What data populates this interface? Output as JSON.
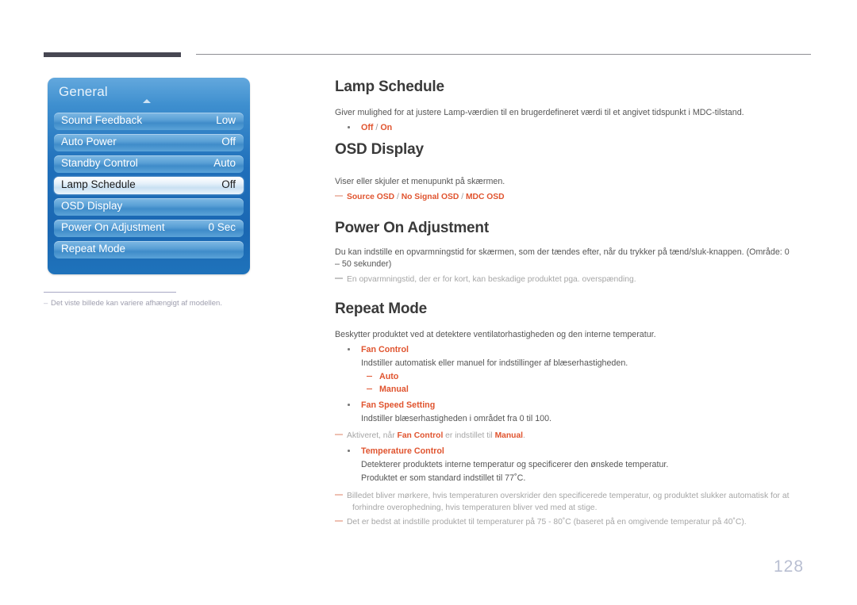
{
  "page": {
    "number": "128",
    "language": "da"
  },
  "osd_menu": {
    "title": "General",
    "caret_icon": "caret-up-icon",
    "rows": [
      {
        "label": "Sound Feedback",
        "value": "Low",
        "selected": false
      },
      {
        "label": "Auto Power",
        "value": "Off",
        "selected": false
      },
      {
        "label": "Standby Control",
        "value": "Auto",
        "selected": false
      },
      {
        "label": "Lamp Schedule",
        "value": "Off",
        "selected": true
      },
      {
        "label": "OSD Display",
        "value": "",
        "selected": false
      },
      {
        "label": "Power On Adjustment",
        "value": "0 Sec",
        "selected": false
      },
      {
        "label": "Repeat Mode",
        "value": "",
        "selected": false
      }
    ],
    "footnote_dash": "–",
    "footnote": "Det viste billede kan variere afhængigt af modellen."
  },
  "sections": {
    "lamp_schedule": {
      "heading": "Lamp Schedule",
      "body": "Giver mulighed for at justere Lamp-værdien til en brugerdefineret værdi til et angivet tidspunkt i MDC-tilstand.",
      "option_off": "Off",
      "option_slash": " / ",
      "option_on": "On"
    },
    "osd_display": {
      "heading": "OSD Display",
      "body": "Viser eller skjuler et menupunkt på skærmen.",
      "opt1": "Source OSD",
      "sep1": " / ",
      "opt2": "No Signal OSD",
      "sep2": " / ",
      "opt3": "MDC OSD"
    },
    "power_on_adjustment": {
      "heading": "Power On Adjustment",
      "body": "Du kan indstille en opvarmningstid for skærmen, som der tændes efter, når du trykker på tænd/sluk-knappen. (Område: 0 – 50 sekunder)",
      "note": "En opvarmningstid, der er for kort, kan beskadige produktet pga. overspænding."
    },
    "repeat_mode": {
      "heading": "Repeat Mode",
      "body": "Beskytter produktet ved at detektere ventilatorhastigheden og den interne temperatur.",
      "fan_control": {
        "label": "Fan Control",
        "desc": "Indstiller automatisk eller manuel for indstillinger af blæserhastigheden.",
        "options": [
          "Auto",
          "Manual"
        ]
      },
      "fan_speed_setting": {
        "label": "Fan Speed Setting",
        "desc": "Indstiller blæserhastigheden i området fra 0 til 100."
      },
      "note_enabled_pre": "Aktiveret, når ",
      "note_enabled_b1": "Fan Control",
      "note_enabled_mid": " er indstillet til ",
      "note_enabled_b2": "Manual",
      "note_enabled_post": ".",
      "temperature_control": {
        "label": "Temperature Control",
        "desc1": "Detekterer produktets interne temperatur og specificerer den ønskede temperatur.",
        "desc2": "Produktet er som standard indstillet til 77˚C."
      },
      "note_overheat_line1": "Billedet bliver mørkere, hvis temperaturen overskrider den specificerede temperatur, og produktet slukker automatisk for at",
      "note_overheat_line2": "forhindre overophedning, hvis temperaturen bliver ved med at stige.",
      "note_best": "Det er bedst at indstille produktet til temperaturer på 75 - 80˚C (baseret på en omgivende temperatur på 40˚C)."
    }
  },
  "colors": {
    "accent_orange": "#e0542f",
    "heading_gray": "#3a3a3a",
    "body_gray": "#565656",
    "note_gray": "#a6a6a6",
    "osd_blue": "#1f6fba",
    "page_number_gray": "#b9bfd2",
    "rule_dark": "#474752"
  }
}
